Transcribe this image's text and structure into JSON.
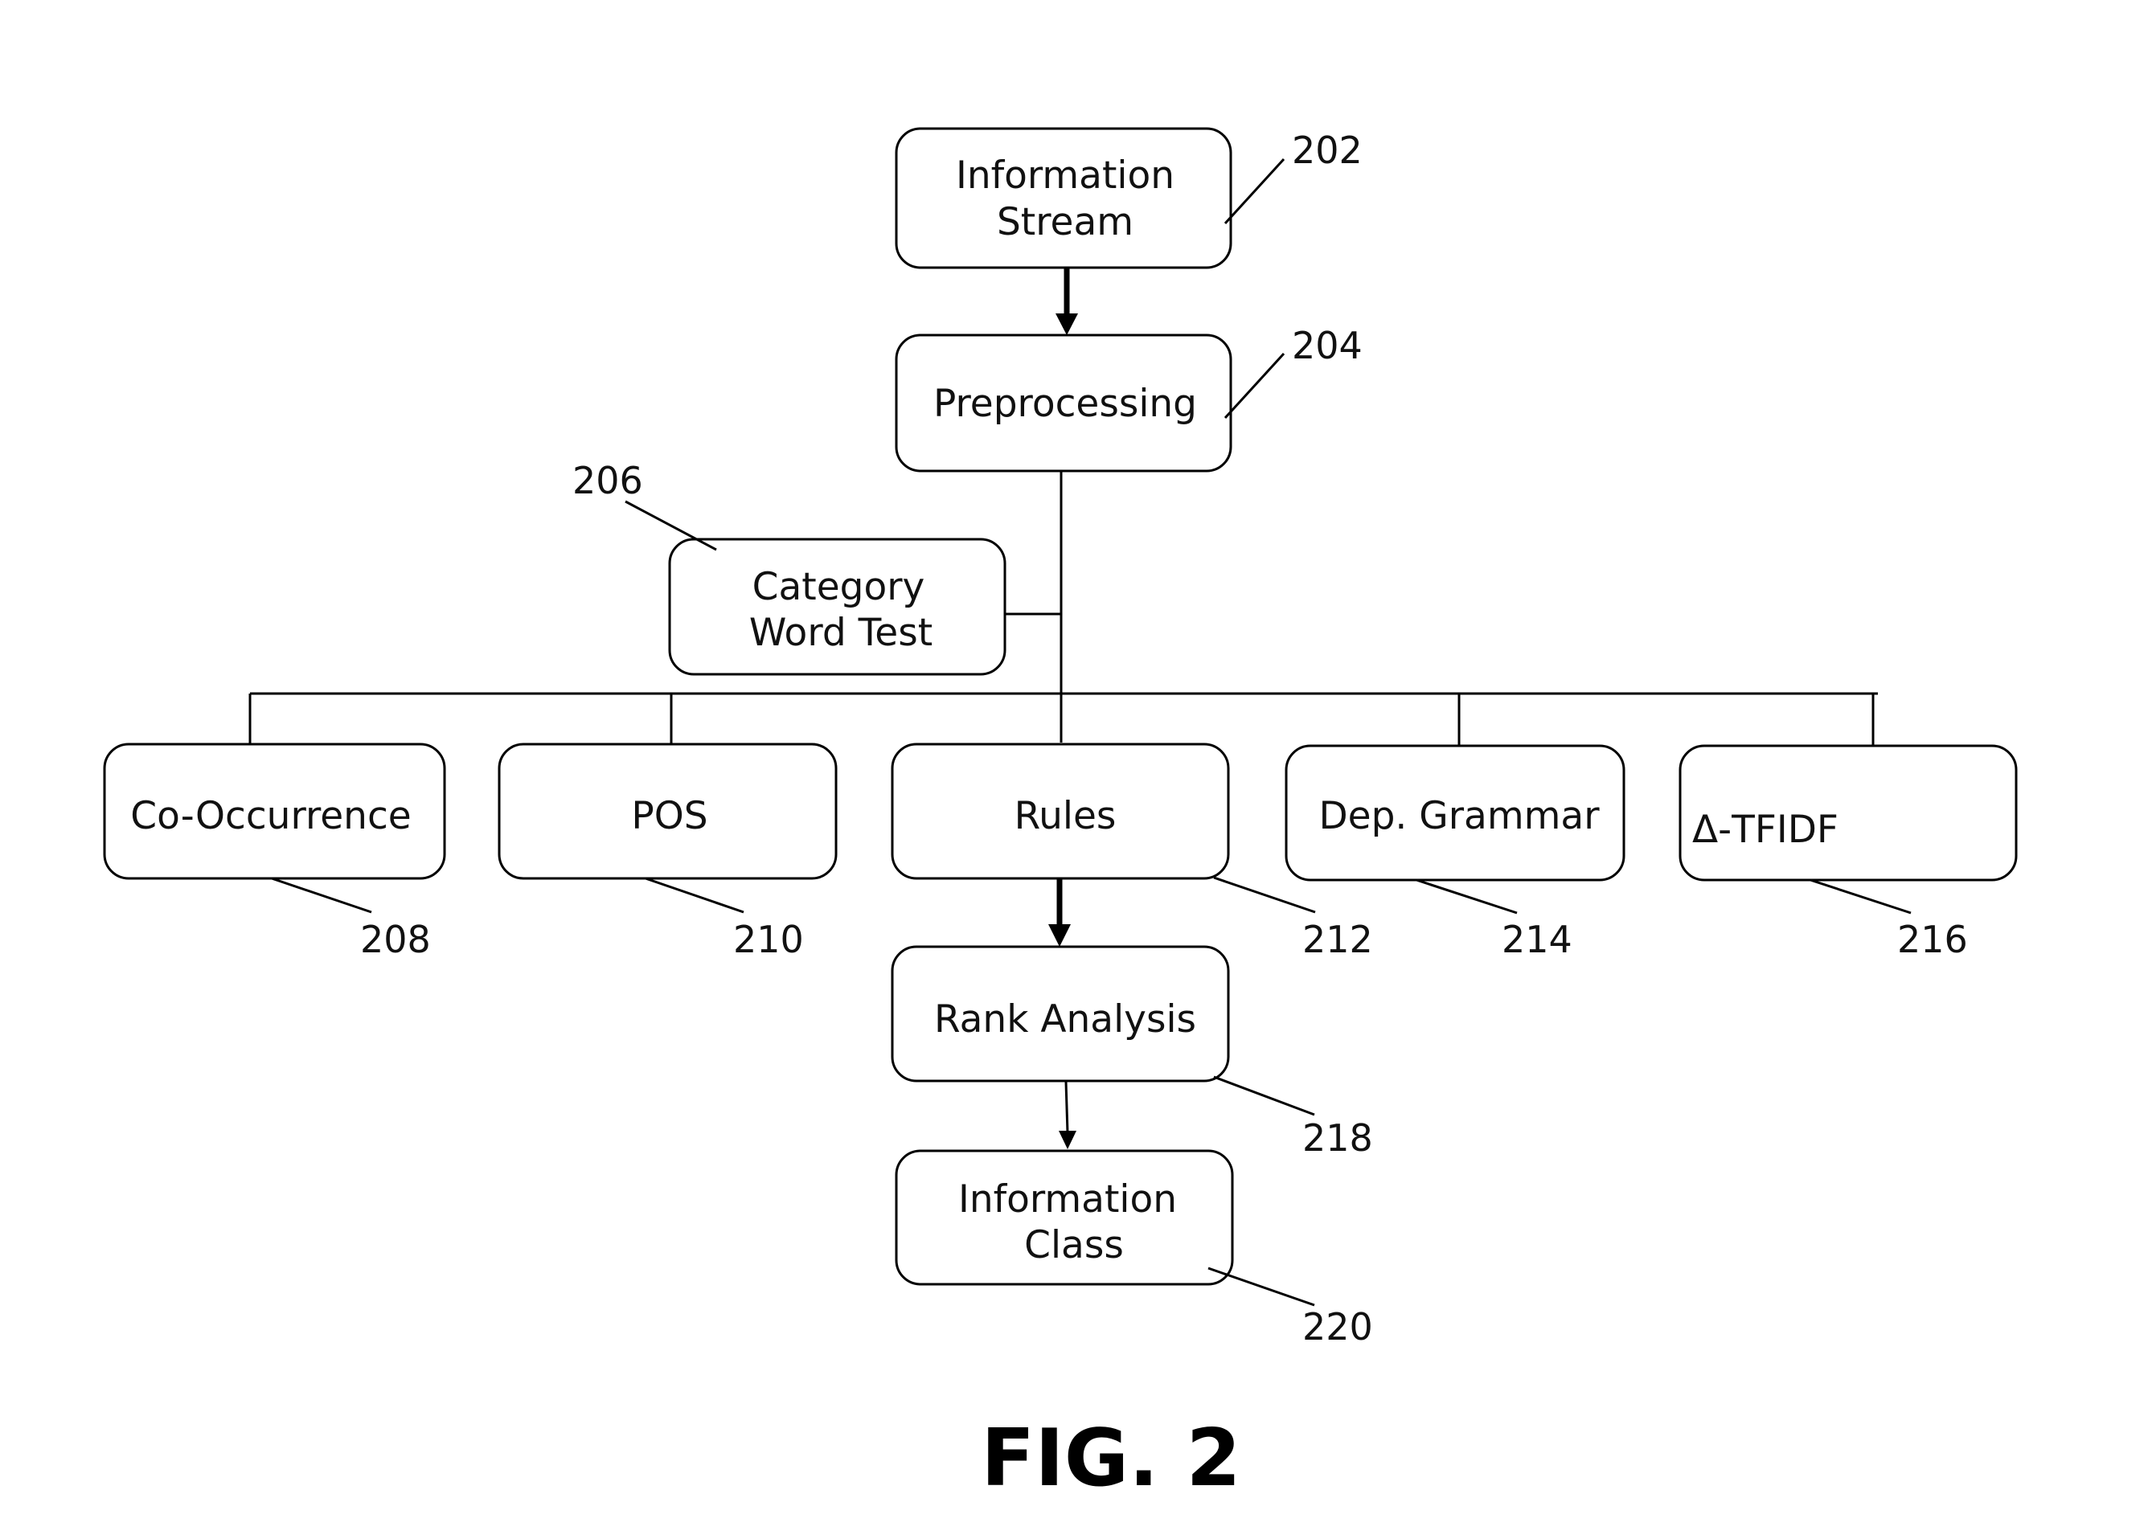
{
  "figure": {
    "caption": "FIG. 2",
    "nodes": [
      {
        "id": "202",
        "lines": [
          "Information",
          "Stream"
        ]
      },
      {
        "id": "204",
        "lines": [
          "Preprocessing"
        ]
      },
      {
        "id": "206",
        "lines": [
          "Category",
          "Word Test"
        ]
      },
      {
        "id": "208",
        "lines": [
          "Co-Occurrence"
        ]
      },
      {
        "id": "210",
        "lines": [
          "POS"
        ]
      },
      {
        "id": "212",
        "lines": [
          "Rules"
        ]
      },
      {
        "id": "214",
        "lines": [
          "Dep. Grammar"
        ]
      },
      {
        "id": "216",
        "lines": [
          "Δ-TFIDF"
        ]
      },
      {
        "id": "218",
        "lines": [
          "Rank Analysis"
        ]
      },
      {
        "id": "220",
        "lines": [
          "Information",
          "Class"
        ]
      }
    ],
    "edges": [
      {
        "from": "202",
        "to": "204",
        "style": "thick-arrow"
      },
      {
        "from": "204",
        "to": "206",
        "style": "line"
      },
      {
        "from": "204",
        "to": "208",
        "style": "line"
      },
      {
        "from": "204",
        "to": "210",
        "style": "line"
      },
      {
        "from": "204",
        "to": "212",
        "style": "line"
      },
      {
        "from": "204",
        "to": "214",
        "style": "line"
      },
      {
        "from": "204",
        "to": "216",
        "style": "line"
      },
      {
        "from": "212",
        "to": "218",
        "style": "thick-arrow"
      },
      {
        "from": "218",
        "to": "220",
        "style": "thin-arrow"
      }
    ]
  }
}
